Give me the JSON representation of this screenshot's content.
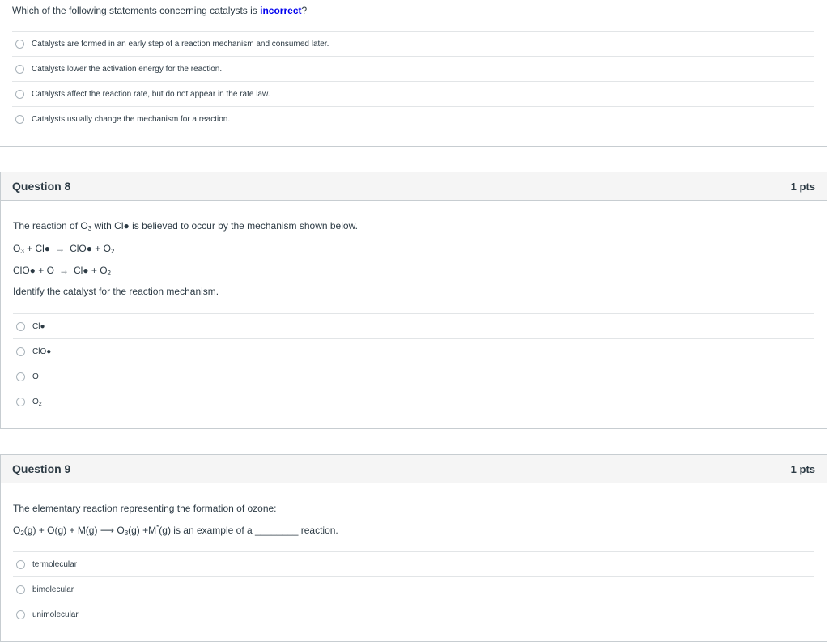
{
  "q7": {
    "prompt_before": "Which of the following statements concerning catalysts is ",
    "prompt_link": "incorrect",
    "prompt_after": "?",
    "answers": [
      "Catalysts are formed in an early step of a reaction mechanism and consumed later.",
      "Catalysts lower the activation energy for the reaction.",
      "Catalysts affect the reaction rate, but do not appear in the rate law.",
      "Catalysts usually change the mechanism for a reaction."
    ]
  },
  "q8": {
    "title": "Question 8",
    "points": "1 pts",
    "intro_a": "The reaction of O",
    "intro_sub": "3",
    "intro_b": " with Cl● is believed to occur by the mechanism shown below.",
    "step1": {
      "lhs_a": "O",
      "lhs_sub": "3",
      "lhs_b": " + Cl●",
      "arrow": "→",
      "rhs_a": "ClO● + O",
      "rhs_sub": "2"
    },
    "step2": {
      "lhs": "ClO● + O",
      "arrow": "→",
      "rhs_a": "Cl● + O",
      "rhs_sub": "2"
    },
    "ask": "Identify the catalyst for the reaction mechanism.",
    "answers": [
      "Cl●",
      "ClO●",
      "O"
    ],
    "last_answer_a": "O",
    "last_answer_sub": "2"
  },
  "q9": {
    "title": "Question 9",
    "points": "1 pts",
    "intro": "The elementary reaction representing the formation of ozone:",
    "eq_a": "O",
    "eq_sub1": "2",
    "eq_b": "(g) + O(g) + M(g) ",
    "eq_arrow": "⟶",
    "eq_c": " O",
    "eq_sub2": "3",
    "eq_d": "(g) +M",
    "eq_sup": "*",
    "eq_e": "(g) is an example of a ________ reaction.",
    "answers": [
      "termolecular",
      "bimolecular",
      "unimolecular"
    ]
  }
}
